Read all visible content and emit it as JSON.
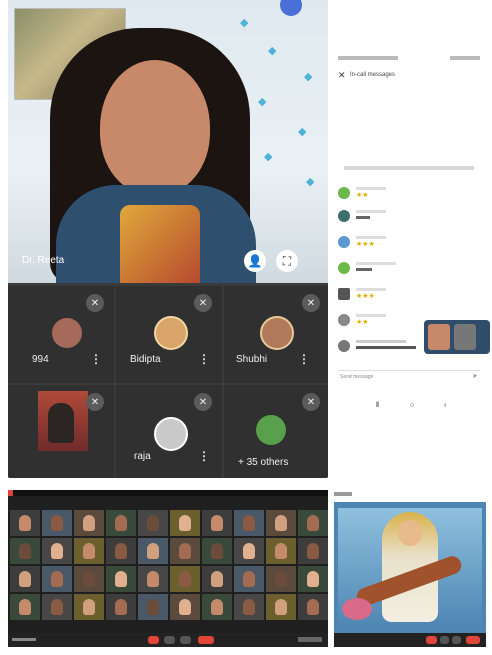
{
  "meeting": {
    "speaker_name": "Dr. Reeta",
    "participants": [
      {
        "label": "994"
      },
      {
        "label": "Bidipta"
      },
      {
        "label": "Shubhi"
      },
      {
        "label": ""
      },
      {
        "label": "raja"
      },
      {
        "label": "+ 35 others"
      }
    ]
  },
  "chat": {
    "header_title": "In-call messages",
    "composer_placeholder": "Send message"
  },
  "colors": {
    "accent_red": "#e0453a",
    "chat_green": "#6db84a",
    "chat_blue": "#5a9ad0"
  }
}
